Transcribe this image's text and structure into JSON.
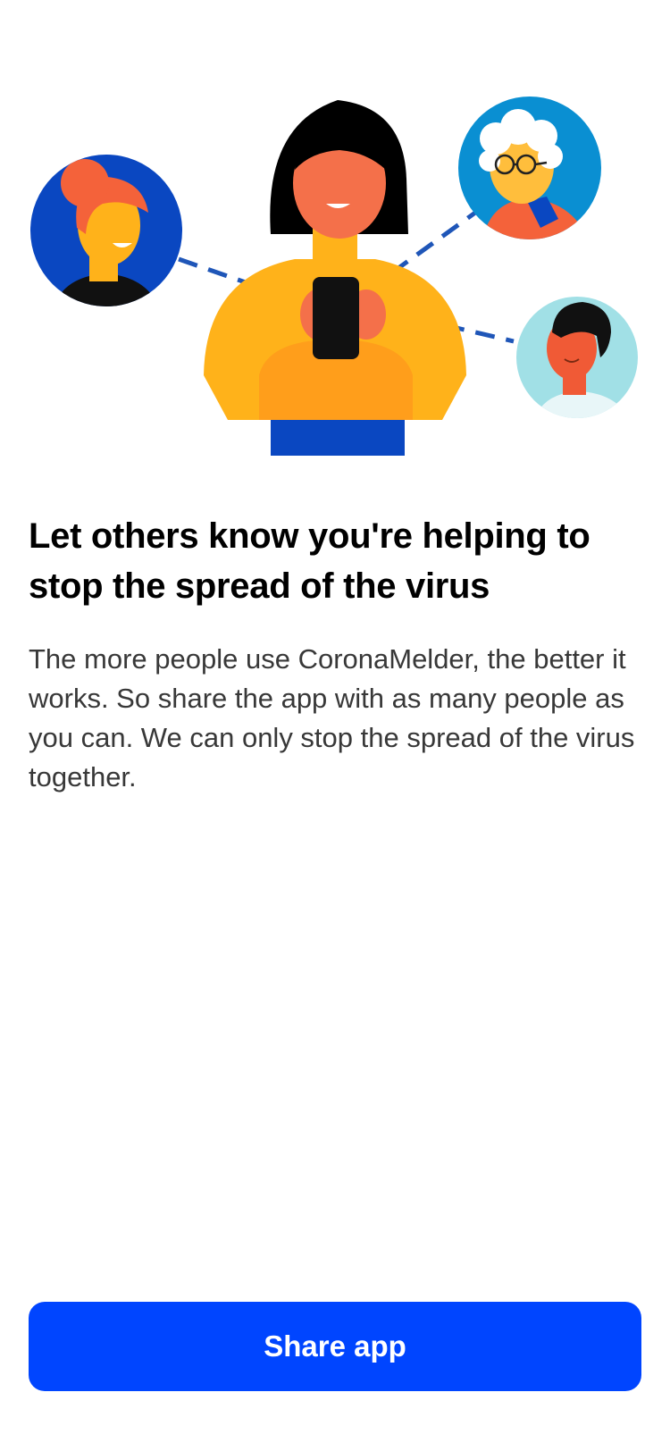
{
  "onboarding": {
    "illustration": "people-sharing-app-illustration",
    "title": "Let others know you're helping to stop the spread of the virus",
    "body": "The more people use CoronaMelder, the better it works. So share the app with as many people as you can. We can only stop the spread of the virus together.",
    "share_button_label": "Share app"
  },
  "colors": {
    "primary": "#0045ff",
    "title_text": "#000000",
    "body_text": "#383838",
    "background": "#ffffff"
  }
}
